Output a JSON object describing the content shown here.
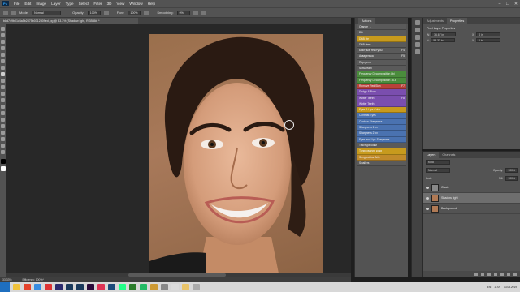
{
  "menu": {
    "logo": "Ps",
    "items": [
      "File",
      "Edit",
      "Image",
      "Layer",
      "Type",
      "Select",
      "Filter",
      "3D",
      "View",
      "Window",
      "Help"
    ],
    "window_controls": [
      "–",
      "❐",
      "✕"
    ]
  },
  "options": {
    "mode_label": "Mode:",
    "mode_value": "Normal",
    "opacity_label": "Opacity:",
    "opacity_value": "100%",
    "flow_label": "Flow:",
    "flow_value": "100%",
    "smoothing_label": "Smoothing:",
    "smoothing_value": "0%"
  },
  "document": {
    "tab_title": "b8d749b01c4a5b2875b0312809ed.jpg @ 33.3% (Shadow light, RGB/8#) *",
    "zoom": "33.33%",
    "efficiency": "Efficiency: 100%*"
  },
  "actions_panel": {
    "title": "Actions",
    "items": [
      {
        "label": "Orange_1",
        "color": "#5a5a5a",
        "shortcut": ""
      },
      {
        "label": "DB",
        "color": "#5a5a5a",
        "shortcut": ""
      },
      {
        "label": "DBB lite",
        "color": "#c79a1d",
        "shortcut": ""
      },
      {
        "label": "DBB view",
        "color": "#5a5a5a",
        "shortcut": ""
      },
      {
        "label": "Быстрые текстуры",
        "color": "#5a5a5a",
        "shortcut": "F4"
      },
      {
        "label": "Акварелька",
        "color": "#5a5a5a",
        "shortcut": "F5"
      },
      {
        "label": "Портреты",
        "color": "#5a5a5a",
        "shortcut": ""
      },
      {
        "label": "SoftDream",
        "color": "#5a5a5a",
        "shortcut": ""
      },
      {
        "label": "Frequency Decomposition 8bi",
        "color": "#4a8c3c",
        "shortcut": ""
      },
      {
        "label": "Frequency Decomposition 16-b",
        "color": "#4a8c3c",
        "shortcut": ""
      },
      {
        "label": "Remove Red Skin",
        "color": "#b8413a",
        "shortcut": "F7"
      },
      {
        "label": "Dodge & Burn",
        "color": "#7a4eae",
        "shortcut": ""
      },
      {
        "label": "Whiter Teeth",
        "color": "#7a4eae",
        "shortcut": "F8"
      },
      {
        "label": "Whiter Teeth",
        "color": "#7a4eae",
        "shortcut": ""
      },
      {
        "label": "Eyes & Lips Color",
        "color": "#c79a1d",
        "shortcut": ""
      },
      {
        "label": "Contrast Eyes",
        "color": "#4a72b0",
        "shortcut": ""
      },
      {
        "label": "Contour Sharpness",
        "color": "#4a72b0",
        "shortcut": ""
      },
      {
        "label": "Sharpness 1 px",
        "color": "#4a72b0",
        "shortcut": ""
      },
      {
        "label": "Sharpness 2 px",
        "color": "#4a72b0",
        "shortcut": ""
      },
      {
        "label": "Eyes and Lips Sharpness",
        "color": "#4a72b0",
        "shortcut": ""
      },
      {
        "label": "Текстура кожи",
        "color": "#5a5a5a",
        "shortcut": ""
      },
      {
        "label": "Тонирование кожи",
        "color": "#c79a1d",
        "shortcut": ""
      },
      {
        "label": "Sunglowkiss Brite",
        "color": "#c08a2a",
        "shortcut": ""
      },
      {
        "label": "Swallers",
        "color": "#5a5a5a",
        "shortcut": ""
      }
    ]
  },
  "properties_panel": {
    "tabs": [
      "Adjustments",
      "Properties"
    ],
    "subtitle": "Pixel Layer Properties",
    "fields": [
      {
        "label": "W:",
        "value": "36.67 in"
      },
      {
        "label": "X:",
        "value": "0 in"
      },
      {
        "label": "H:",
        "value": "53.33 in"
      },
      {
        "label": "Y:",
        "value": "0 in"
      }
    ]
  },
  "layers_panel": {
    "tabs": [
      "Layers",
      "Channels"
    ],
    "kind_label": "Kind",
    "blend_mode": "Normal",
    "opacity_label": "Opacity:",
    "opacity_value": "100%",
    "lock_label": "Lock:",
    "fill_label": "Fill:",
    "fill_value": "100%",
    "layers": [
      {
        "name": "Chats",
        "selected": false,
        "thumb": "#888888"
      },
      {
        "name": "Shadow light",
        "selected": true,
        "thumb": "#b07a55"
      },
      {
        "name": "Background",
        "selected": false,
        "thumb": "#b07a55"
      }
    ]
  },
  "taskbar": {
    "apps": [
      "#f0c23b",
      "#e5432c",
      "#3a8de0",
      "#d33",
      "#2b2b6e",
      "#1a3a5c",
      "#1a3a5c",
      "#2a0a3a",
      "#d35",
      "#1b4a7a",
      "#2f8",
      "#2b7d2b",
      "#2b6",
      "#c93",
      "#888",
      "#ddd",
      "#e9c46a",
      "#aaa"
    ],
    "lang": "EN",
    "time": "11:09",
    "date": "13.03.2019"
  },
  "colors": {
    "brand": "#31a8ff",
    "panel_bg": "#535353",
    "dark_bg": "#282828"
  }
}
